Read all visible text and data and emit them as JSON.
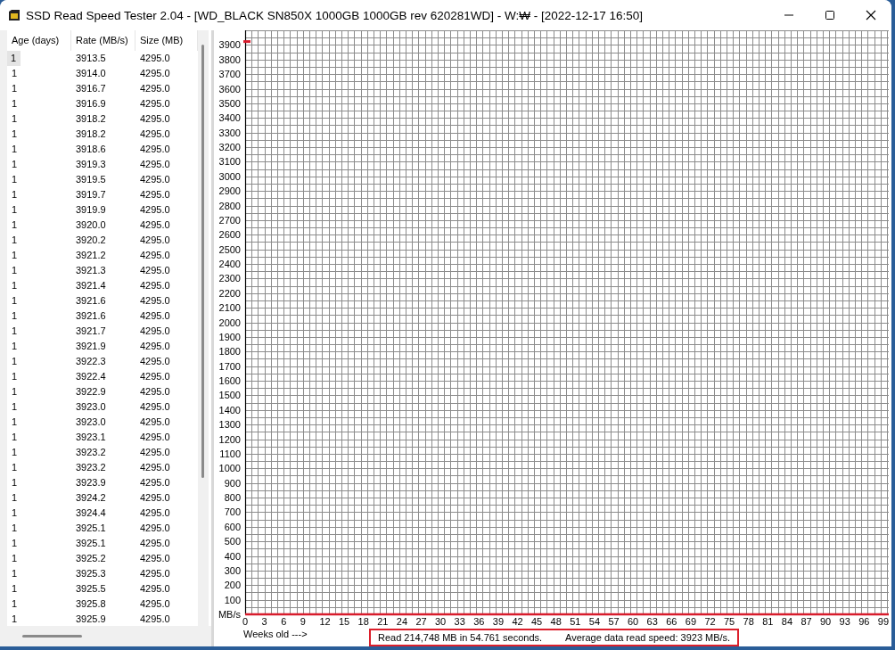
{
  "window": {
    "title": "SSD Read Speed Tester 2.04 - [WD_BLACK SN850X 1000GB 1000GB rev 620281WD] - W:₩ - [2022-12-17 16:50]"
  },
  "list": {
    "columns": [
      "Age (days)",
      "Rate (MB/s)",
      "Size (MB)"
    ],
    "rows": [
      {
        "cells": [
          "1",
          "3913.5",
          "4295.0"
        ],
        "selected": true
      },
      {
        "cells": [
          "1",
          "3914.0",
          "4295.0"
        ],
        "selected": false
      },
      {
        "cells": [
          "1",
          "3916.7",
          "4295.0"
        ],
        "selected": false
      },
      {
        "cells": [
          "1",
          "3916.9",
          "4295.0"
        ],
        "selected": false
      },
      {
        "cells": [
          "1",
          "3918.2",
          "4295.0"
        ],
        "selected": false
      },
      {
        "cells": [
          "1",
          "3918.2",
          "4295.0"
        ],
        "selected": false
      },
      {
        "cells": [
          "1",
          "3918.6",
          "4295.0"
        ],
        "selected": false
      },
      {
        "cells": [
          "1",
          "3919.3",
          "4295.0"
        ],
        "selected": false
      },
      {
        "cells": [
          "1",
          "3919.5",
          "4295.0"
        ],
        "selected": false
      },
      {
        "cells": [
          "1",
          "3919.7",
          "4295.0"
        ],
        "selected": false
      },
      {
        "cells": [
          "1",
          "3919.9",
          "4295.0"
        ],
        "selected": false
      },
      {
        "cells": [
          "1",
          "3920.0",
          "4295.0"
        ],
        "selected": false
      },
      {
        "cells": [
          "1",
          "3920.2",
          "4295.0"
        ],
        "selected": false
      },
      {
        "cells": [
          "1",
          "3921.2",
          "4295.0"
        ],
        "selected": false
      },
      {
        "cells": [
          "1",
          "3921.3",
          "4295.0"
        ],
        "selected": false
      },
      {
        "cells": [
          "1",
          "3921.4",
          "4295.0"
        ],
        "selected": false
      },
      {
        "cells": [
          "1",
          "3921.6",
          "4295.0"
        ],
        "selected": false
      },
      {
        "cells": [
          "1",
          "3921.6",
          "4295.0"
        ],
        "selected": false
      },
      {
        "cells": [
          "1",
          "3921.7",
          "4295.0"
        ],
        "selected": false
      },
      {
        "cells": [
          "1",
          "3921.9",
          "4295.0"
        ],
        "selected": false
      },
      {
        "cells": [
          "1",
          "3922.3",
          "4295.0"
        ],
        "selected": false
      },
      {
        "cells": [
          "1",
          "3922.4",
          "4295.0"
        ],
        "selected": false
      },
      {
        "cells": [
          "1",
          "3922.9",
          "4295.0"
        ],
        "selected": false
      },
      {
        "cells": [
          "1",
          "3923.0",
          "4295.0"
        ],
        "selected": false
      },
      {
        "cells": [
          "1",
          "3923.0",
          "4295.0"
        ],
        "selected": false
      },
      {
        "cells": [
          "1",
          "3923.1",
          "4295.0"
        ],
        "selected": false
      },
      {
        "cells": [
          "1",
          "3923.2",
          "4295.0"
        ],
        "selected": false
      },
      {
        "cells": [
          "1",
          "3923.2",
          "4295.0"
        ],
        "selected": false
      },
      {
        "cells": [
          "1",
          "3923.9",
          "4295.0"
        ],
        "selected": false
      },
      {
        "cells": [
          "1",
          "3924.2",
          "4295.0"
        ],
        "selected": false
      },
      {
        "cells": [
          "1",
          "3924.4",
          "4295.0"
        ],
        "selected": false
      },
      {
        "cells": [
          "1",
          "3925.1",
          "4295.0"
        ],
        "selected": false
      },
      {
        "cells": [
          "1",
          "3925.1",
          "4295.0"
        ],
        "selected": false
      },
      {
        "cells": [
          "1",
          "3925.2",
          "4295.0"
        ],
        "selected": false
      },
      {
        "cells": [
          "1",
          "3925.3",
          "4295.0"
        ],
        "selected": false
      },
      {
        "cells": [
          "1",
          "3925.5",
          "4295.0"
        ],
        "selected": false
      },
      {
        "cells": [
          "1",
          "3925.8",
          "4295.0"
        ],
        "selected": false
      },
      {
        "cells": [
          "1",
          "3925.9",
          "4295.0"
        ],
        "selected": false
      }
    ]
  },
  "chart": {
    "chart_data": {
      "type": "scatter",
      "xlabel": "Weeks old --->",
      "x": [
        0
      ],
      "series": [
        {
          "color": "#d81c2c",
          "values": [
            3923
          ]
        }
      ],
      "xlim": [
        0,
        100
      ],
      "ylim": [
        0,
        4000
      ],
      "xticks": [
        0,
        3,
        6,
        9,
        12,
        15,
        18,
        21,
        24,
        27,
        30,
        33,
        36,
        39,
        42,
        45,
        48,
        51,
        54,
        57,
        60,
        63,
        66,
        69,
        72,
        75,
        78,
        81,
        84,
        87,
        90,
        93,
        96,
        99
      ],
      "grid": true,
      "yticks": [
        {
          "value": 0,
          "label": "MB/s"
        },
        100,
        200,
        300,
        400,
        500,
        600,
        700,
        800,
        900,
        1000,
        1100,
        1200,
        1300,
        1400,
        1500,
        1600,
        1700,
        1800,
        1900,
        2000,
        2100,
        2200,
        2300,
        2400,
        2500,
        2600,
        2700,
        2800,
        2900,
        3000,
        3100,
        3200,
        3300,
        3400,
        3500,
        3600,
        3700,
        3800,
        3900
      ]
    }
  },
  "status_bar": {
    "summary": "Read 214,748 MB in 54.761 seconds.",
    "average": "Average data read speed: 3923 MB/s."
  }
}
